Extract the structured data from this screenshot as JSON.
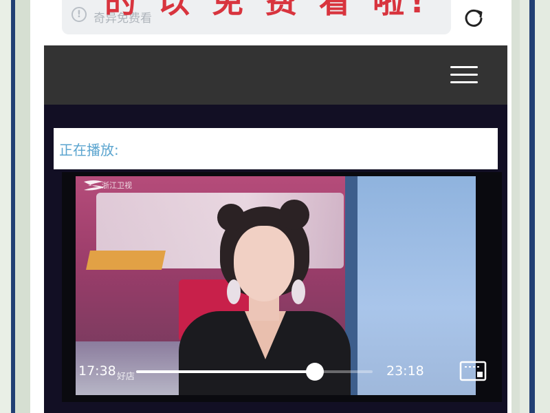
{
  "browser": {
    "url_text": "奇异免费看",
    "overlay_caption": "的 以 免 费 看 啦!"
  },
  "page": {
    "now_playing_label": "正在播放:"
  },
  "player": {
    "current_time": "17:38",
    "total_time": "23:18",
    "progress_fraction": 0.757,
    "watermark_text": "好店",
    "channel_logo_text": "浙江卫视"
  },
  "icons": {
    "info": "info-icon",
    "reload": "reload-icon",
    "menu": "hamburger-menu-icon",
    "fullscreen": "fullscreen-icon"
  },
  "colors": {
    "header_bg": "#333333",
    "content_bg": "#120f24",
    "now_playing_text": "#5aa4cf",
    "overlay_caption": "#d8343e"
  }
}
